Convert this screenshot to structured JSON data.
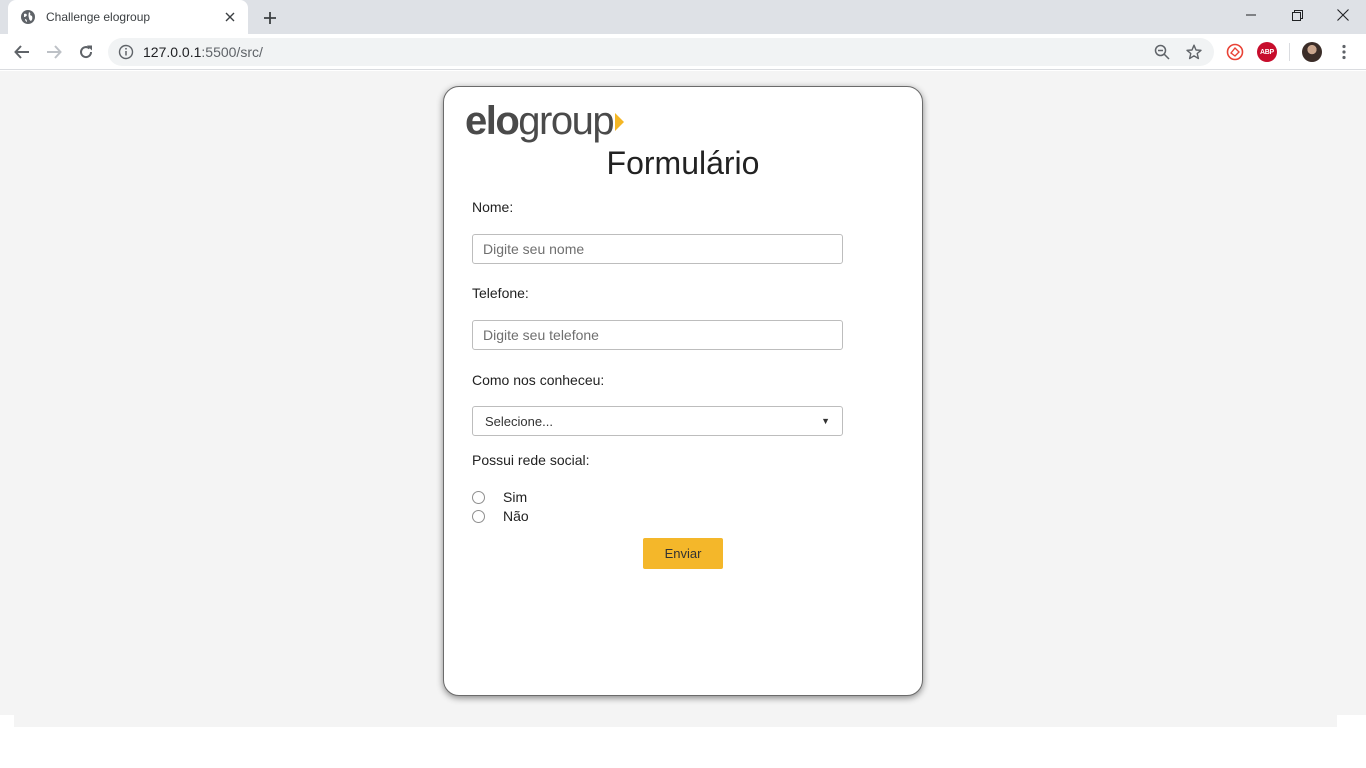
{
  "browser": {
    "tab_title": "Challenge elogroup",
    "url_host": "127.0.0.1",
    "url_rest": ":5500/src/",
    "abp_label": "ABP"
  },
  "logo": {
    "bold": "elo",
    "light": "group",
    "accent_color": "#f4b624"
  },
  "form": {
    "title": "Formulário",
    "name_label": "Nome:",
    "name_placeholder": "Digite seu nome",
    "phone_label": "Telefone:",
    "phone_placeholder": "Digite seu telefone",
    "source_label": "Como nos conheceu:",
    "source_selected": "Selecione...",
    "social_label": "Possui rede social:",
    "options": [
      "Sim",
      "Não"
    ],
    "submit_label": "Enviar",
    "button_color": "#f4b72a"
  }
}
